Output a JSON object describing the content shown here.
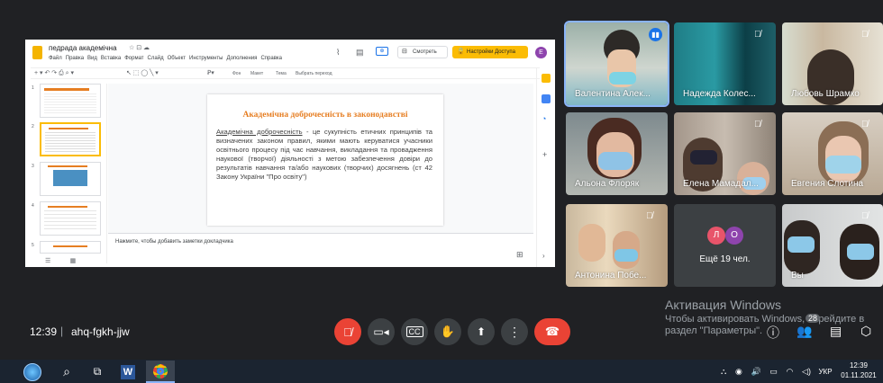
{
  "slides_app": {
    "doc_title": "педрада академічна",
    "menu": [
      "Файл",
      "Правка",
      "Вид",
      "Вставка",
      "Формат",
      "Слайд",
      "Объект",
      "Инструменты",
      "Дополнения",
      "Справка"
    ],
    "present_label": "Смотреть",
    "share_label": "Настройки Доступа",
    "avatar_letter": "Е",
    "toolbar_items": [
      "Фон",
      "Макет",
      "Тема",
      "Выбрать переход"
    ],
    "notes_placeholder": "Нажмите, чтобы добавить заметки докладчика",
    "thumb_numbers": [
      "1",
      "2",
      "3",
      "4",
      "5"
    ],
    "slide": {
      "title": "Академічна доброчесність в законодавстві",
      "term": "Академічна доброчесність",
      "body": " - це сукупність етичних принципів та визначених законом правил, якими мають керуватися учасники освітнього процесу під час навчання, викладання та провадження наукової (творчої) діяльності з метою забезпечення довіри до результатів навчання та/або наукових (творчих) досягнень (ст 42 Закону України \"Про освіту\")"
    }
  },
  "participants": [
    {
      "name": "Валентина Алек..."
    },
    {
      "name": "Надежда Колес..."
    },
    {
      "name": "Любовь Шрамко"
    },
    {
      "name": "Альона Флоряк"
    },
    {
      "name": "Елена Мамадал..."
    },
    {
      "name": "Евгения Слотина"
    },
    {
      "name": "Антонина Побе..."
    },
    {
      "name": "Вы"
    }
  ],
  "others": {
    "avatars": [
      "Л",
      "О"
    ],
    "label": "Ещё 19 чел."
  },
  "activation": {
    "title": "Активация Windows",
    "line1": "Чтобы активировать Windows, перейдите в",
    "line2": "раздел \"Параметры\"."
  },
  "meeting": {
    "time": "12:39",
    "code": "ahq-fgkh-jjw",
    "participants_count": "28"
  },
  "taskbar": {
    "lang": "УКР",
    "time": "12:39",
    "date": "01.11.2021",
    "word_letter": "W"
  },
  "colors": {
    "accent": "#8ab4f8",
    "end_call": "#ea4335",
    "share_btn": "#fbbc04",
    "slide_title": "#e67e22"
  }
}
